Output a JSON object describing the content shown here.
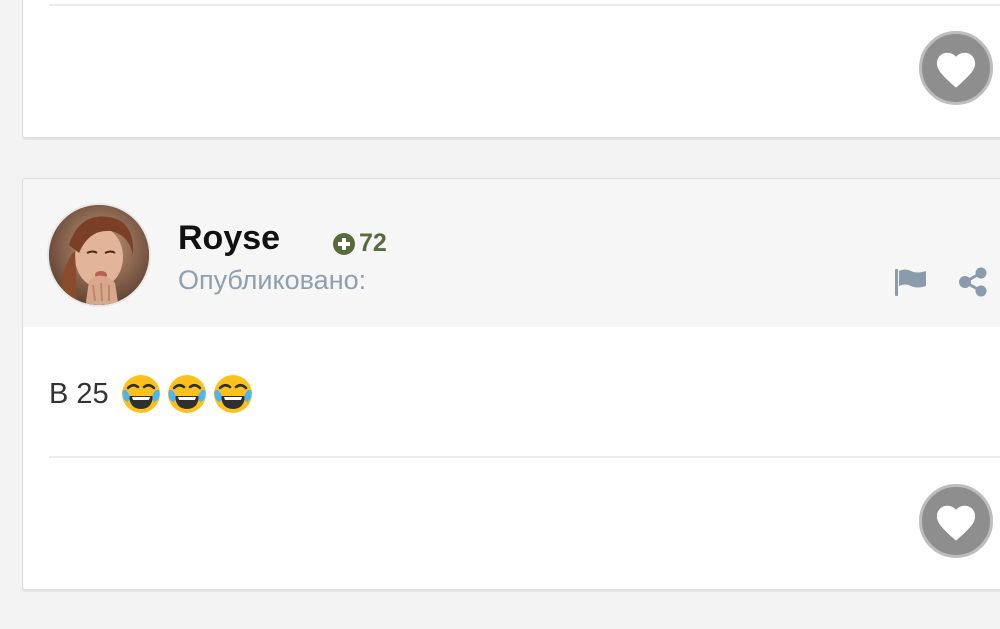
{
  "previous_post": {
    "like_icon": "heart-icon"
  },
  "post": {
    "author": "Royse",
    "reputation": "72",
    "published_label": "Опубликовано:",
    "text": "В 25",
    "emoji": [
      "😂",
      "😂",
      "😂"
    ],
    "like_icon": "heart-icon",
    "header_actions": [
      "flag-icon",
      "share-icon"
    ]
  },
  "colors": {
    "reputation": "#576b3f",
    "published": "#8f9fae",
    "like_button": "#8e8e8e"
  }
}
